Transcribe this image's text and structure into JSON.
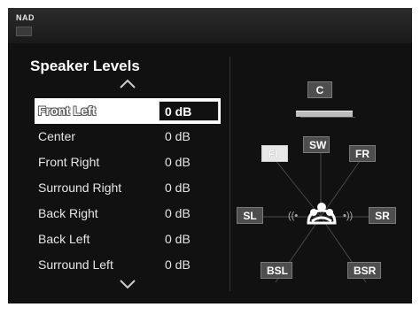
{
  "header": {
    "brand": "NAD"
  },
  "menu": {
    "title": "Speaker Levels",
    "items": [
      {
        "name": "Front Left",
        "value": "0 dB",
        "selected": true
      },
      {
        "name": "Center",
        "value": "0 dB"
      },
      {
        "name": "Front Right",
        "value": "0 dB"
      },
      {
        "name": "Surround Right",
        "value": "0 dB"
      },
      {
        "name": "Back Right",
        "value": "0 dB"
      },
      {
        "name": "Back Left",
        "value": "0 dB"
      },
      {
        "name": "Surround Left",
        "value": "0 dB"
      }
    ]
  },
  "layout_diagram": {
    "center": "C",
    "subwoofer": "SW",
    "front_left": "FL",
    "front_right": "FR",
    "surround_left": "SL",
    "surround_right": "SR",
    "back_surround_left": "BSL",
    "back_surround_right": "BSR",
    "wave_left": "((•",
    "wave_right": "•))"
  },
  "colors": {
    "background": "#111111",
    "selection": "#ffffff",
    "chip": "#4e4e4e"
  },
  "icons": {
    "scroll_up": "chevron-up-icon",
    "scroll_down": "chevron-down-icon",
    "listener": "listener-icon"
  }
}
